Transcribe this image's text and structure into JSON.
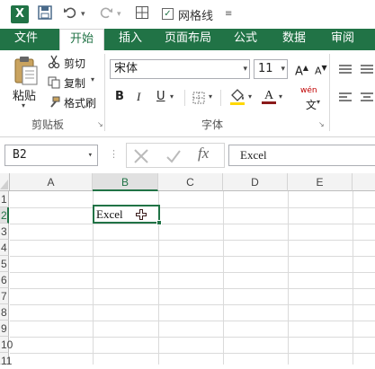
{
  "qat": {
    "app_icon": "X",
    "gridlines_label": "网格线",
    "gridlines_checked": true
  },
  "tabs": [
    {
      "label": "文件"
    },
    {
      "label": "开始"
    },
    {
      "label": "插入"
    },
    {
      "label": "页面布局"
    },
    {
      "label": "公式"
    },
    {
      "label": "数据"
    },
    {
      "label": "审阅"
    }
  ],
  "active_tab": "开始",
  "ribbon": {
    "clipboard": {
      "paste_label": "粘贴",
      "cut_label": "剪切",
      "copy_label": "复制",
      "format_painter_label": "格式刷",
      "group_label": "剪贴板"
    },
    "font": {
      "font_name": "宋体",
      "font_size": "11",
      "bold": "B",
      "italic": "I",
      "underline": "U",
      "phonetic": "wén",
      "group_label": "字体"
    }
  },
  "formula_bar": {
    "name_box": "B2",
    "formula": "Excel",
    "fx_label": "fx"
  },
  "grid": {
    "columns": [
      "A",
      "B",
      "C",
      "D",
      "E"
    ],
    "selected_column": "B",
    "rows": [
      "1",
      "2",
      "3",
      "4",
      "5",
      "6",
      "7",
      "8",
      "9",
      "10",
      "11"
    ],
    "selected_row": "2",
    "active_cell_value": "Excel"
  },
  "colors": {
    "accent": "#217346"
  }
}
